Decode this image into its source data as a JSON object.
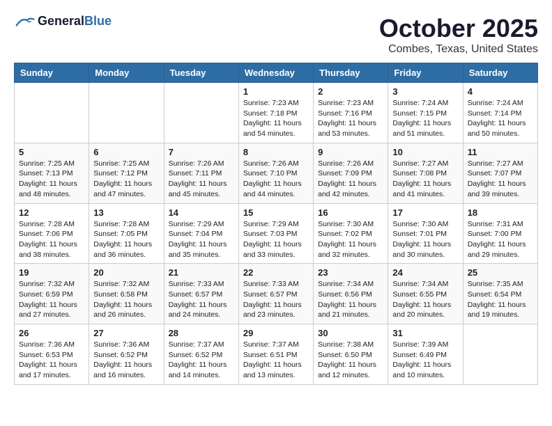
{
  "header": {
    "logo_general": "General",
    "logo_blue": "Blue",
    "month_year": "October 2025",
    "location": "Combes, Texas, United States"
  },
  "days_of_week": [
    "Sunday",
    "Monday",
    "Tuesday",
    "Wednesday",
    "Thursday",
    "Friday",
    "Saturday"
  ],
  "weeks": [
    [
      {
        "day": "",
        "info": ""
      },
      {
        "day": "",
        "info": ""
      },
      {
        "day": "",
        "info": ""
      },
      {
        "day": "1",
        "sunrise": "Sunrise: 7:23 AM",
        "sunset": "Sunset: 7:18 PM",
        "daylight": "Daylight: 11 hours and 54 minutes."
      },
      {
        "day": "2",
        "sunrise": "Sunrise: 7:23 AM",
        "sunset": "Sunset: 7:16 PM",
        "daylight": "Daylight: 11 hours and 53 minutes."
      },
      {
        "day": "3",
        "sunrise": "Sunrise: 7:24 AM",
        "sunset": "Sunset: 7:15 PM",
        "daylight": "Daylight: 11 hours and 51 minutes."
      },
      {
        "day": "4",
        "sunrise": "Sunrise: 7:24 AM",
        "sunset": "Sunset: 7:14 PM",
        "daylight": "Daylight: 11 hours and 50 minutes."
      }
    ],
    [
      {
        "day": "5",
        "sunrise": "Sunrise: 7:25 AM",
        "sunset": "Sunset: 7:13 PM",
        "daylight": "Daylight: 11 hours and 48 minutes."
      },
      {
        "day": "6",
        "sunrise": "Sunrise: 7:25 AM",
        "sunset": "Sunset: 7:12 PM",
        "daylight": "Daylight: 11 hours and 47 minutes."
      },
      {
        "day": "7",
        "sunrise": "Sunrise: 7:26 AM",
        "sunset": "Sunset: 7:11 PM",
        "daylight": "Daylight: 11 hours and 45 minutes."
      },
      {
        "day": "8",
        "sunrise": "Sunrise: 7:26 AM",
        "sunset": "Sunset: 7:10 PM",
        "daylight": "Daylight: 11 hours and 44 minutes."
      },
      {
        "day": "9",
        "sunrise": "Sunrise: 7:26 AM",
        "sunset": "Sunset: 7:09 PM",
        "daylight": "Daylight: 11 hours and 42 minutes."
      },
      {
        "day": "10",
        "sunrise": "Sunrise: 7:27 AM",
        "sunset": "Sunset: 7:08 PM",
        "daylight": "Daylight: 11 hours and 41 minutes."
      },
      {
        "day": "11",
        "sunrise": "Sunrise: 7:27 AM",
        "sunset": "Sunset: 7:07 PM",
        "daylight": "Daylight: 11 hours and 39 minutes."
      }
    ],
    [
      {
        "day": "12",
        "sunrise": "Sunrise: 7:28 AM",
        "sunset": "Sunset: 7:06 PM",
        "daylight": "Daylight: 11 hours and 38 minutes."
      },
      {
        "day": "13",
        "sunrise": "Sunrise: 7:28 AM",
        "sunset": "Sunset: 7:05 PM",
        "daylight": "Daylight: 11 hours and 36 minutes."
      },
      {
        "day": "14",
        "sunrise": "Sunrise: 7:29 AM",
        "sunset": "Sunset: 7:04 PM",
        "daylight": "Daylight: 11 hours and 35 minutes."
      },
      {
        "day": "15",
        "sunrise": "Sunrise: 7:29 AM",
        "sunset": "Sunset: 7:03 PM",
        "daylight": "Daylight: 11 hours and 33 minutes."
      },
      {
        "day": "16",
        "sunrise": "Sunrise: 7:30 AM",
        "sunset": "Sunset: 7:02 PM",
        "daylight": "Daylight: 11 hours and 32 minutes."
      },
      {
        "day": "17",
        "sunrise": "Sunrise: 7:30 AM",
        "sunset": "Sunset: 7:01 PM",
        "daylight": "Daylight: 11 hours and 30 minutes."
      },
      {
        "day": "18",
        "sunrise": "Sunrise: 7:31 AM",
        "sunset": "Sunset: 7:00 PM",
        "daylight": "Daylight: 11 hours and 29 minutes."
      }
    ],
    [
      {
        "day": "19",
        "sunrise": "Sunrise: 7:32 AM",
        "sunset": "Sunset: 6:59 PM",
        "daylight": "Daylight: 11 hours and 27 minutes."
      },
      {
        "day": "20",
        "sunrise": "Sunrise: 7:32 AM",
        "sunset": "Sunset: 6:58 PM",
        "daylight": "Daylight: 11 hours and 26 minutes."
      },
      {
        "day": "21",
        "sunrise": "Sunrise: 7:33 AM",
        "sunset": "Sunset: 6:57 PM",
        "daylight": "Daylight: 11 hours and 24 minutes."
      },
      {
        "day": "22",
        "sunrise": "Sunrise: 7:33 AM",
        "sunset": "Sunset: 6:57 PM",
        "daylight": "Daylight: 11 hours and 23 minutes."
      },
      {
        "day": "23",
        "sunrise": "Sunrise: 7:34 AM",
        "sunset": "Sunset: 6:56 PM",
        "daylight": "Daylight: 11 hours and 21 minutes."
      },
      {
        "day": "24",
        "sunrise": "Sunrise: 7:34 AM",
        "sunset": "Sunset: 6:55 PM",
        "daylight": "Daylight: 11 hours and 20 minutes."
      },
      {
        "day": "25",
        "sunrise": "Sunrise: 7:35 AM",
        "sunset": "Sunset: 6:54 PM",
        "daylight": "Daylight: 11 hours and 19 minutes."
      }
    ],
    [
      {
        "day": "26",
        "sunrise": "Sunrise: 7:36 AM",
        "sunset": "Sunset: 6:53 PM",
        "daylight": "Daylight: 11 hours and 17 minutes."
      },
      {
        "day": "27",
        "sunrise": "Sunrise: 7:36 AM",
        "sunset": "Sunset: 6:52 PM",
        "daylight": "Daylight: 11 hours and 16 minutes."
      },
      {
        "day": "28",
        "sunrise": "Sunrise: 7:37 AM",
        "sunset": "Sunset: 6:52 PM",
        "daylight": "Daylight: 11 hours and 14 minutes."
      },
      {
        "day": "29",
        "sunrise": "Sunrise: 7:37 AM",
        "sunset": "Sunset: 6:51 PM",
        "daylight": "Daylight: 11 hours and 13 minutes."
      },
      {
        "day": "30",
        "sunrise": "Sunrise: 7:38 AM",
        "sunset": "Sunset: 6:50 PM",
        "daylight": "Daylight: 11 hours and 12 minutes."
      },
      {
        "day": "31",
        "sunrise": "Sunrise: 7:39 AM",
        "sunset": "Sunset: 6:49 PM",
        "daylight": "Daylight: 11 hours and 10 minutes."
      },
      {
        "day": "",
        "info": ""
      }
    ]
  ]
}
